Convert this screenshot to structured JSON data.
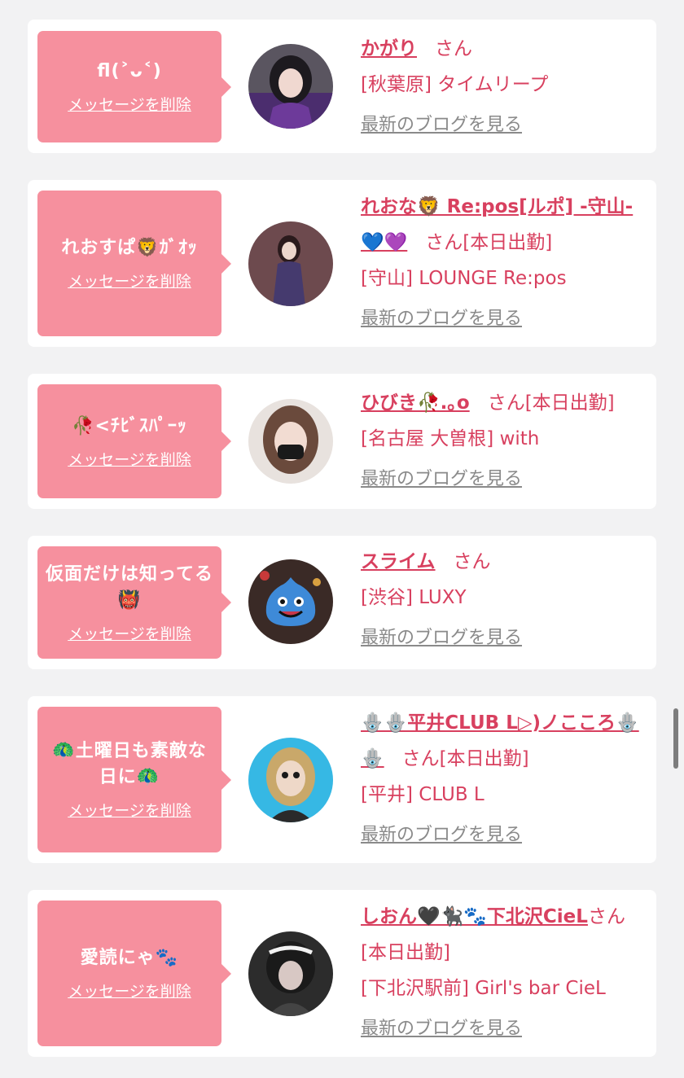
{
  "delete_label": "メッセージを削除",
  "blog_label": "最新のブログを見る",
  "san_label": "さん",
  "accent_color": "#d8405f",
  "bubble_color": "#f6909e",
  "items": [
    {
      "message": "ﬂ(˃ᴗ˂)",
      "name": "かがり",
      "status": "",
      "shop": "[秋葉原] タイムリープ"
    },
    {
      "message": "れおすぱ🦁ｶﾞｵｯ",
      "name": "れおな🦁 Re:pos[ルポ] -守山-💙💜",
      "status": "[本日出勤]",
      "shop": "[守山] LOUNGE Re:pos"
    },
    {
      "message": "🥀<ﾁﾋﾞｽﾊﾟｰｯ",
      "name": "ひびき🥀.｡o",
      "status": "[本日出勤]",
      "shop": "[名古屋 大曽根] with"
    },
    {
      "message": "仮面だけは知ってる👹",
      "name": "スライム",
      "status": "",
      "shop": "[渋谷] LUXY"
    },
    {
      "message": "🦚土曜日も素敵な日に🦚",
      "name": "🪬🪬平井CLUB L▷)ノこころ🪬🪬",
      "status": "[本日出勤]",
      "shop": "[平井] CLUB L"
    },
    {
      "message": "愛読にゃ🐾",
      "name": "しおん🖤🐈‍⬛🐾下北沢CieL",
      "status": "[本日出勤]",
      "shop": "[下北沢駅前] Girl's bar CieL"
    }
  ]
}
